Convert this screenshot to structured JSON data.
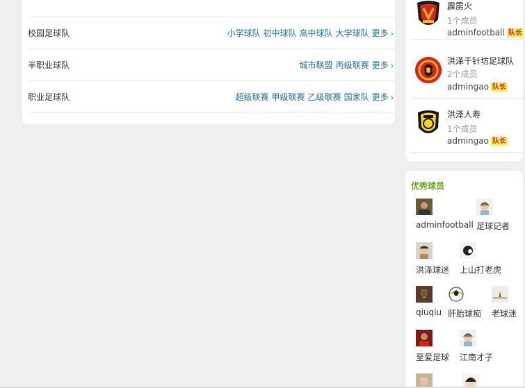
{
  "categories": [
    {
      "name": "校园足球队",
      "links": [
        "小学球队",
        "初中球队",
        "高中球队",
        "大学球队"
      ],
      "more": "更多"
    },
    {
      "name": "半职业球队",
      "links": [
        "城市联盟",
        "丙级联赛"
      ],
      "more": "更多"
    },
    {
      "name": "职业足球队",
      "links": [
        "超级联赛",
        "甲级联赛",
        "乙级联赛",
        "国家队"
      ],
      "more": "更多"
    }
  ],
  "teams": [
    {
      "name": "霹雳火",
      "members": "1个成员",
      "owner": "adminfootball",
      "badge": "队长"
    },
    {
      "name": "洪泽千针坊足球队",
      "members": "2个成员",
      "owner": "admingao",
      "badge": "队长"
    },
    {
      "name": "洪泽人寿",
      "members": "1个成员",
      "owner": "admingao",
      "badge": "队长"
    }
  ],
  "players_section": {
    "title": "优秀球员",
    "players": [
      {
        "name": "adminfootball"
      },
      {
        "name": "足球记者"
      },
      {
        "name": "洪泽球迷"
      },
      {
        "name": "上山打老虎"
      },
      {
        "name": "qiuqiu"
      },
      {
        "name": "肝胎球痴"
      },
      {
        "name": "老球迷"
      },
      {
        "name": "至爱足球"
      },
      {
        "name": "江南才子"
      }
    ]
  },
  "colors": {
    "link": "#2a6f90",
    "accent_green": "#6aa31f",
    "captain_bg": "#ffee55",
    "captain_fg": "#d03030"
  }
}
